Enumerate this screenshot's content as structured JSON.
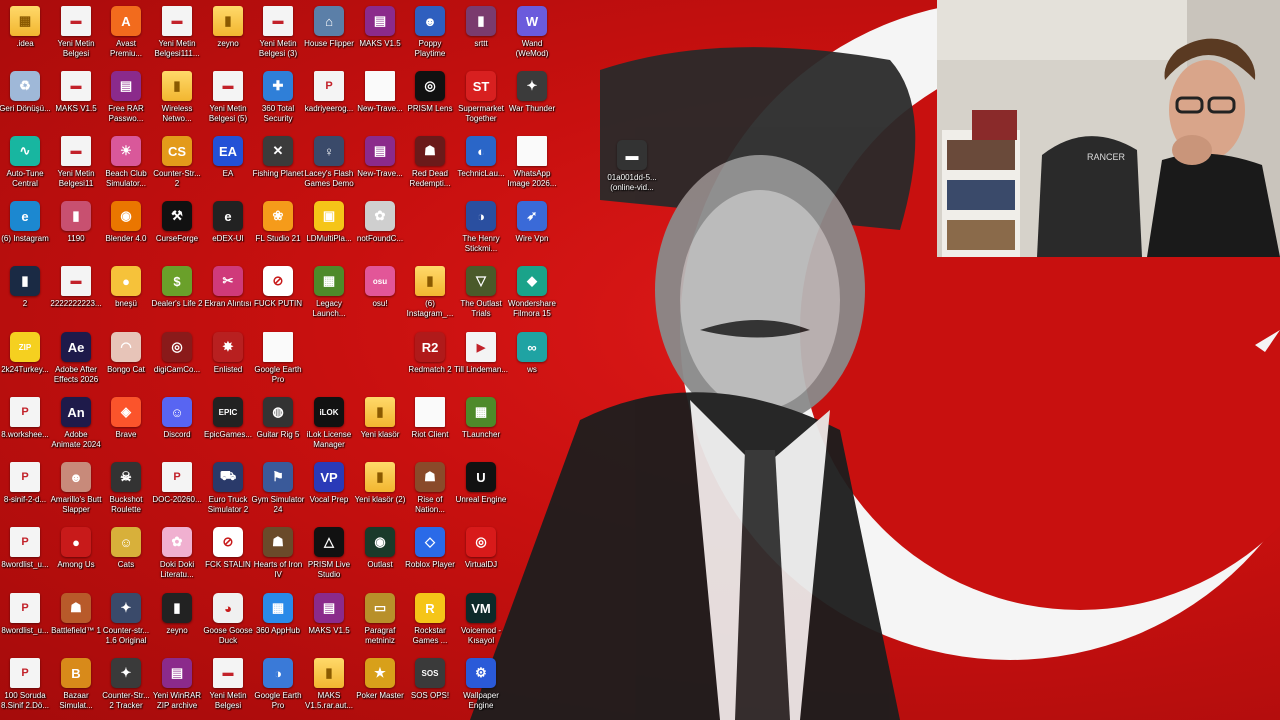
{
  "desktop": {
    "icons": [
      {
        "label": ".idea",
        "glyph": "▦",
        "color": "#3a7bd5",
        "kind": "folder"
      },
      {
        "label": "Yeni Metin Belgesi",
        "glyph": "▬",
        "color": "#e9e9e9",
        "kind": "doc"
      },
      {
        "label": "Avast Premiu...",
        "glyph": "A",
        "color": "#f26b1d",
        "kind": "app"
      },
      {
        "label": "Yeni Metin Belgesi111...",
        "glyph": "▬",
        "color": "#e9e9e9",
        "kind": "doc"
      },
      {
        "label": "zeyno",
        "glyph": "▮",
        "color": "#c9a34a",
        "kind": "folder"
      },
      {
        "label": "Yeni Metin Belgesi (3)",
        "glyph": "▬",
        "color": "#e9e9e9",
        "kind": "doc"
      },
      {
        "label": "House Flipper",
        "glyph": "⌂",
        "color": "#5b7fa8",
        "kind": "app"
      },
      {
        "label": "MAKS V1.5",
        "glyph": "▤",
        "color": "#8b2a8b",
        "kind": "app"
      },
      {
        "label": "Poppy Playtime",
        "glyph": "☻",
        "color": "#2f5fbf",
        "kind": "app"
      },
      {
        "label": "srttt",
        "glyph": "▮",
        "color": "#7a3b6e",
        "kind": "app"
      },
      {
        "label": "Wand (WeMod)",
        "glyph": "W",
        "color": "#6b5bdc",
        "kind": "app"
      },
      {
        "label": "Geri Dönüşü...",
        "glyph": "♻",
        "color": "#9fb8d8",
        "kind": "app"
      },
      {
        "label": "MAKS V1.5",
        "glyph": "▬",
        "color": "#e9e9e9",
        "kind": "doc"
      },
      {
        "label": "Free RAR Passwo...",
        "glyph": "▤",
        "color": "#8b2a8b",
        "kind": "app"
      },
      {
        "label": "Wireless Netwo...",
        "glyph": "▮",
        "color": "#ffd96a",
        "kind": "folder"
      },
      {
        "label": "Yeni Metin Belgesi (5)",
        "glyph": "▬",
        "color": "#e9e9e9",
        "kind": "doc"
      },
      {
        "label": "360 Total Security",
        "glyph": "✚",
        "color": "#2f7fd8",
        "kind": "app"
      },
      {
        "label": "kadriyeerog...",
        "glyph": "P",
        "color": "#e23b3b",
        "kind": "doc"
      },
      {
        "label": "New-Trave...",
        "glyph": "",
        "color": "#fafafa",
        "kind": "blank"
      },
      {
        "label": "PRISM Lens",
        "glyph": "◎",
        "color": "#111111",
        "kind": "app"
      },
      {
        "label": "Supermarket Together",
        "glyph": "ST",
        "color": "#d82020",
        "kind": "app"
      },
      {
        "label": "War Thunder",
        "glyph": "✦",
        "color": "#3b3b3b",
        "kind": "app"
      },
      {
        "label": "Auto-Tune Central",
        "glyph": "∿",
        "color": "#18b6a0",
        "kind": "app"
      },
      {
        "label": "Yeni Metin Belgesi11",
        "glyph": "▬",
        "color": "#e9e9e9",
        "kind": "doc"
      },
      {
        "label": "Beach Club Simulator...",
        "glyph": "☀",
        "color": "#d9589a",
        "kind": "app"
      },
      {
        "label": "Counter-Str... 2",
        "glyph": "CS",
        "color": "#e39a1a",
        "kind": "app"
      },
      {
        "label": "EA",
        "glyph": "EA",
        "color": "#2351d6",
        "kind": "app"
      },
      {
        "label": "Fishing Planet",
        "glyph": "✕",
        "color": "#3b3b3b",
        "kind": "app"
      },
      {
        "label": "Lacey's Flash Games Demo",
        "glyph": "♀",
        "color": "#3a4a6a",
        "kind": "app"
      },
      {
        "label": "New-Trave...",
        "glyph": "▤",
        "color": "#8b2a8b",
        "kind": "app"
      },
      {
        "label": "Red Dead Redempti...",
        "glyph": "☗",
        "color": "#6b1a1a",
        "kind": "app"
      },
      {
        "label": "TechnicLau...",
        "glyph": "◐",
        "color": "#2a66c8",
        "kind": "app"
      },
      {
        "label": "WhatsApp Image 2026...",
        "glyph": "",
        "color": "#fafafa",
        "kind": "blank"
      },
      {
        "label": "(6) Instagram",
        "glyph": "e",
        "color": "#1c88d0",
        "kind": "app"
      },
      {
        "label": "1190",
        "glyph": "▮",
        "color": "#c85070",
        "kind": "app"
      },
      {
        "label": "Blender 4.0",
        "glyph": "◉",
        "color": "#ea7600",
        "kind": "app"
      },
      {
        "label": "CurseForge",
        "glyph": "⚒",
        "color": "#111111",
        "kind": "app"
      },
      {
        "label": "eDEX-UI",
        "glyph": "e",
        "color": "#222222",
        "kind": "app"
      },
      {
        "label": "FL Studio 21",
        "glyph": "❀",
        "color": "#f59b1a",
        "kind": "app"
      },
      {
        "label": "LDMultiPla...",
        "glyph": "▣",
        "color": "#f5c518",
        "kind": "app"
      },
      {
        "label": "notFoundC...",
        "glyph": "✿",
        "color": "#cfcfcf",
        "kind": "app"
      },
      {
        "label": "The Henry Stickmi...",
        "glyph": "◑",
        "color": "#2a4fa0",
        "kind": "app"
      },
      {
        "label": "Wire Vpn",
        "glyph": "➶",
        "color": "#3a6ad8",
        "kind": "app"
      },
      {
        "label": "2",
        "glyph": "▮",
        "color": "#1a2a44",
        "kind": "app"
      },
      {
        "label": "2222222223...",
        "glyph": "▬",
        "color": "#e9e9e9",
        "kind": "doc"
      },
      {
        "label": "bneşü",
        "glyph": "●",
        "color": "#f6c23a",
        "kind": "app"
      },
      {
        "label": "Dealer's Life 2",
        "glyph": "$",
        "color": "#6aa02a",
        "kind": "app"
      },
      {
        "label": "Ekran Alıntısı",
        "glyph": "✂",
        "color": "#cf3a7a",
        "kind": "app"
      },
      {
        "label": "FUCK PUTIN",
        "glyph": "⊘",
        "color": "#ffffff",
        "kind": "app"
      },
      {
        "label": "Legacy Launch...",
        "glyph": "▦",
        "color": "#4e8a2a",
        "kind": "app"
      },
      {
        "label": "osu!",
        "glyph": "osu",
        "color": "#e25698",
        "kind": "app"
      },
      {
        "label": "(6) Instagram_...",
        "glyph": "▮",
        "color": "#ffd96a",
        "kind": "folder"
      },
      {
        "label": "The Outlast Trials",
        "glyph": "▽",
        "color": "#4a5a2a",
        "kind": "app"
      },
      {
        "label": "Wondershare Filmora 15",
        "glyph": "◆",
        "color": "#1aa38a",
        "kind": "app"
      },
      {
        "label": "2k24Turkey...",
        "glyph": "ZIP",
        "color": "#f5d020",
        "kind": "app"
      },
      {
        "label": "Adobe After Effects 2026",
        "glyph": "Ae",
        "color": "#1e1a4a",
        "kind": "app"
      },
      {
        "label": "Bongo Cat",
        "glyph": "◠",
        "color": "#e7c4b8",
        "kind": "app"
      },
      {
        "label": "digiCamCo...",
        "glyph": "◎",
        "color": "#8a1a1a",
        "kind": "app"
      },
      {
        "label": "Enlisted",
        "glyph": "✸",
        "color": "#b82020",
        "kind": "app"
      },
      {
        "label": "Google Earth Pro",
        "glyph": "",
        "color": "#fafafa",
        "kind": "blank"
      },
      {
        "label": "Redmatch 2",
        "glyph": "R2",
        "color": "#b01a1a",
        "kind": "app"
      },
      {
        "label": "Till Lindeman...",
        "glyph": "▶",
        "color": "#f0f0f0",
        "kind": "doc"
      },
      {
        "label": "ws",
        "glyph": "∞",
        "color": "#1fa3a3",
        "kind": "app"
      },
      {
        "label": "8.workshee...",
        "glyph": "P",
        "color": "#e23b3b",
        "kind": "doc"
      },
      {
        "label": "Adobe Animate 2024",
        "glyph": "An",
        "color": "#1e1a4a",
        "kind": "app"
      },
      {
        "label": "Brave",
        "glyph": "◈",
        "color": "#fb542b",
        "kind": "app"
      },
      {
        "label": "Discord",
        "glyph": "☺",
        "color": "#5865f2",
        "kind": "app"
      },
      {
        "label": "EpicGames...",
        "glyph": "EPIC",
        "color": "#222222",
        "kind": "app"
      },
      {
        "label": "Guitar Rig 5",
        "glyph": "◍",
        "color": "#333333",
        "kind": "app"
      },
      {
        "label": "iLok License Manager",
        "glyph": "iLOK",
        "color": "#111111",
        "kind": "app"
      },
      {
        "label": "Yeni klasör",
        "glyph": "▮",
        "color": "#ffd96a",
        "kind": "folder"
      },
      {
        "label": "Riot Client",
        "glyph": "",
        "color": "#fafafa",
        "kind": "blank"
      },
      {
        "label": "TLauncher",
        "glyph": "▦",
        "color": "#4e8a2a",
        "kind": "app"
      },
      {
        "label": "8-sinif-2-d...",
        "glyph": "P",
        "color": "#e23b3b",
        "kind": "doc"
      },
      {
        "label": "Amarillo's Butt Slapper",
        "glyph": "☻",
        "color": "#c88a7a",
        "kind": "app"
      },
      {
        "label": "Buckshot Roulette",
        "glyph": "☠",
        "color": "#333333",
        "kind": "app"
      },
      {
        "label": "DOC-20260...",
        "glyph": "P",
        "color": "#e23b3b",
        "kind": "doc"
      },
      {
        "label": "Euro Truck Simulator 2",
        "glyph": "⛟",
        "color": "#2a3a6a",
        "kind": "app"
      },
      {
        "label": "Gym Simulator 24",
        "glyph": "⚑",
        "color": "#3a5a9a",
        "kind": "app"
      },
      {
        "label": "Vocal Prep",
        "glyph": "VP",
        "color": "#2a3ab8",
        "kind": "app"
      },
      {
        "label": "Yeni klasör (2)",
        "glyph": "▮",
        "color": "#ffd96a",
        "kind": "folder"
      },
      {
        "label": "Rise of Nation...",
        "glyph": "☗",
        "color": "#8a4a2a",
        "kind": "app"
      },
      {
        "label": "Unreal Engine",
        "glyph": "U",
        "color": "#111111",
        "kind": "app"
      },
      {
        "label": "8wordlist_u...",
        "glyph": "P",
        "color": "#e23b3b",
        "kind": "doc"
      },
      {
        "label": "Among Us",
        "glyph": "●",
        "color": "#c81a1a",
        "kind": "app"
      },
      {
        "label": "Cats",
        "glyph": "☺",
        "color": "#d8b03a",
        "kind": "app"
      },
      {
        "label": "Doki Doki Literatu...",
        "glyph": "✿",
        "color": "#f0b0d0",
        "kind": "app"
      },
      {
        "label": "FCK STALIN",
        "glyph": "⊘",
        "color": "#ffffff",
        "kind": "app"
      },
      {
        "label": "Hearts of Iron IV",
        "glyph": "☗",
        "color": "#6a4a2a",
        "kind": "app"
      },
      {
        "label": "PRISM Live Studio",
        "glyph": "△",
        "color": "#111111",
        "kind": "app"
      },
      {
        "label": "Outlast",
        "glyph": "◉",
        "color": "#1a3a2a",
        "kind": "app"
      },
      {
        "label": "Roblox Player",
        "glyph": "◇",
        "color": "#2a6ae8",
        "kind": "app"
      },
      {
        "label": "VirtualDJ",
        "glyph": "◎",
        "color": "#d81a1a",
        "kind": "app"
      },
      {
        "label": "8wordlist_u...",
        "glyph": "P",
        "color": "#e23b3b",
        "kind": "doc"
      },
      {
        "label": "Battlefield™ 1",
        "glyph": "☗",
        "color": "#b85a2a",
        "kind": "app"
      },
      {
        "label": "Counter-str... 1.6 Original",
        "glyph": "✦",
        "color": "#3a4a6a",
        "kind": "app"
      },
      {
        "label": "zeyno",
        "glyph": "▮",
        "color": "#222222",
        "kind": "app"
      },
      {
        "label": "Goose Goose Duck",
        "glyph": "◕",
        "color": "#f0f0f0",
        "kind": "app"
      },
      {
        "label": "360 AppHub",
        "glyph": "▦",
        "color": "#2a8ae8",
        "kind": "app"
      },
      {
        "label": "MAKS V1.5",
        "glyph": "▤",
        "color": "#8b2a8b",
        "kind": "app"
      },
      {
        "label": "Paragraf metniniz",
        "glyph": "▭",
        "color": "#b8902a",
        "kind": "app"
      },
      {
        "label": "Rockstar Games ...",
        "glyph": "R",
        "color": "#f5c518",
        "kind": "app"
      },
      {
        "label": "Voicemod - Kısayol",
        "glyph": "VM",
        "color": "#0d2a2a",
        "kind": "app"
      },
      {
        "label": "100 Soruda 8.Sinif 2.Dö...",
        "glyph": "P",
        "color": "#e23b3b",
        "kind": "doc"
      },
      {
        "label": "Bazaar Simulat...",
        "glyph": "B",
        "color": "#d88a1a",
        "kind": "app"
      },
      {
        "label": "Counter-Str... 2 Tracker",
        "glyph": "✦",
        "color": "#3a3a3a",
        "kind": "app"
      },
      {
        "label": "Yeni WinRAR ZIP archive",
        "glyph": "▤",
        "color": "#8b2a8b",
        "kind": "app"
      },
      {
        "label": "Yeni Metin Belgesi",
        "glyph": "▬",
        "color": "#e9e9e9",
        "kind": "doc"
      },
      {
        "label": "Google Earth Pro",
        "glyph": "◑",
        "color": "#3a7ad8",
        "kind": "app"
      },
      {
        "label": "MAKS V1.5.rar.aut...",
        "glyph": "▮",
        "color": "#ffd96a",
        "kind": "folder"
      },
      {
        "label": "Poker Master",
        "glyph": "★",
        "color": "#d8a01a",
        "kind": "app"
      },
      {
        "label": "SOS OPS!",
        "glyph": "SOS",
        "color": "#3a3a3a",
        "kind": "app"
      },
      {
        "label": "Wallpaper Engine",
        "glyph": "⚙",
        "color": "#2a5ad8",
        "kind": "app"
      },
      {
        "label": "01a001dd-5... (online-vid...",
        "glyph": "▬",
        "color": "#333333",
        "kind": "app"
      }
    ],
    "webcam": {
      "chair_text": "RANCER"
    }
  }
}
